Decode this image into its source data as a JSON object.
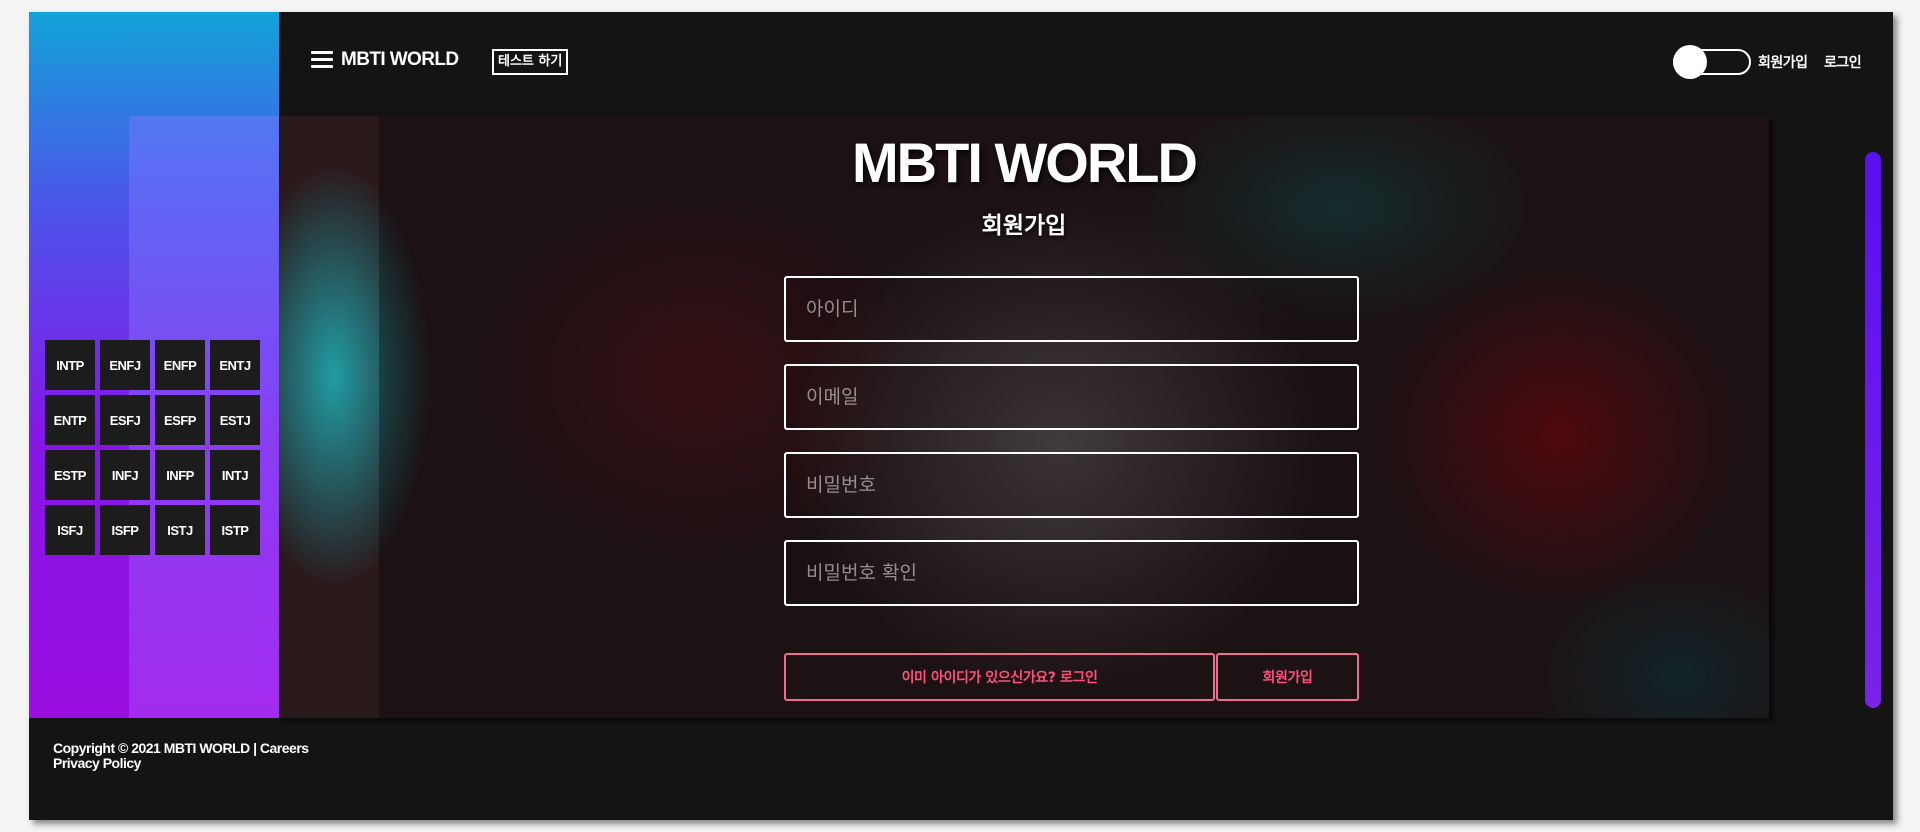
{
  "header": {
    "brand": "MBTI WORLD",
    "test_button": "테스트 하기",
    "signup_link": "회원가입",
    "login_link": "로그인"
  },
  "mbti_types": [
    "INTP",
    "ENFJ",
    "ENFP",
    "ENTJ",
    "ENTP",
    "ESFJ",
    "ESFP",
    "ESTJ",
    "ESTP",
    "INFJ",
    "INFP",
    "INTJ",
    "ISFJ",
    "ISFP",
    "ISTJ",
    "ISTP"
  ],
  "hero": {
    "title": "MBTI WORLD",
    "subtitle": "회원가입"
  },
  "form": {
    "id_placeholder": "아이디",
    "email_placeholder": "이메일",
    "password_placeholder": "비밀번호",
    "password_confirm_placeholder": "비밀번호 확인",
    "login_prompt": "이미 아이디가 있으신가요?  로그인",
    "submit": "회원가입"
  },
  "footer": {
    "line1": "Copyright © 2021 MBTI WORLD | Careers",
    "line2": "Privacy Policy"
  },
  "colors": {
    "accent_pink": "#f06d92",
    "scroll_purple": "#6a17ec",
    "sidebar_top": "#12a2d8",
    "sidebar_bottom": "#9a0ee0"
  },
  "icons": [
    "menu-icon",
    "theme-toggle"
  ]
}
